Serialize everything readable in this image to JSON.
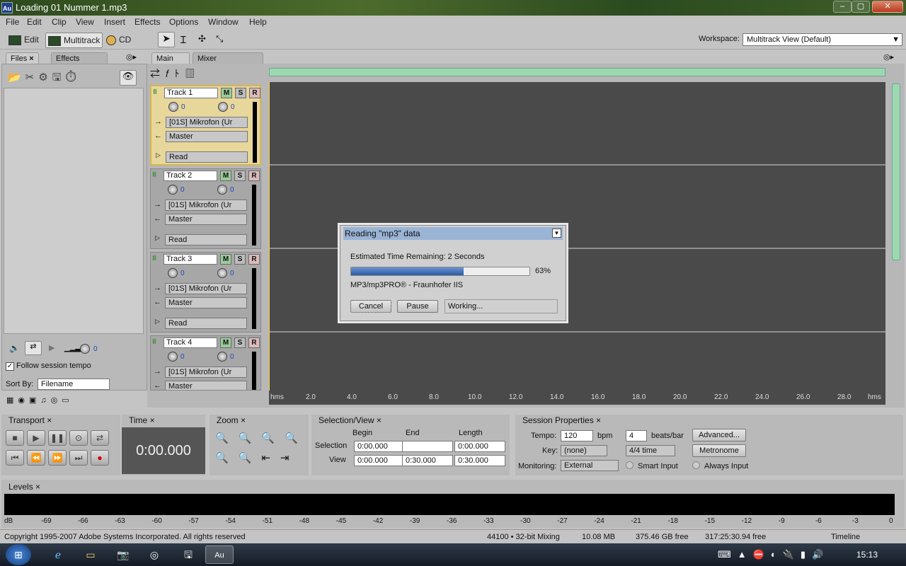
{
  "app": {
    "icon": "Au",
    "title": "Loading 01 Nummer 1.mp3"
  },
  "window_buttons": [
    "–",
    "▢",
    "✕"
  ],
  "menu": [
    "File",
    "Edit",
    "Clip",
    "View",
    "Insert",
    "Effects",
    "Options",
    "Window",
    "Help"
  ],
  "toolbar": {
    "edit": "Edit",
    "multitrack": "Multitrack",
    "cd": "CD",
    "workspace_label": "Workspace:",
    "workspace_value": "Multitrack View (Default)"
  },
  "files_panel": {
    "tabs": [
      "Files",
      "Effects"
    ],
    "close": "×",
    "follow_tempo": "Follow session tempo",
    "sort_by": "Sort By:",
    "sort_value": "Filename",
    "vol": "0"
  },
  "main_tabs": [
    "Main",
    "Mixer"
  ],
  "tracks": [
    {
      "name": "Track 1",
      "vol": "0",
      "pan": "0",
      "input": "[01S] Mikrofon (Ur",
      "output": "Master",
      "auto": "Read"
    },
    {
      "name": "Track 2",
      "vol": "0",
      "pan": "0",
      "input": "[01S] Mikrofon (Ur",
      "output": "Master",
      "auto": "Read"
    },
    {
      "name": "Track 3",
      "vol": "0",
      "pan": "0",
      "input": "[01S] Mikrofon (Ur",
      "output": "Master",
      "auto": "Read"
    },
    {
      "name": "Track 4",
      "vol": "0",
      "pan": "0",
      "input": "[01S] Mikrofon (Ur",
      "output": "Master",
      "auto": ""
    }
  ],
  "msr": [
    "M",
    "S",
    "R"
  ],
  "ruler": [
    "hms",
    "2.0",
    "4.0",
    "6.0",
    "8.0",
    "10.0",
    "12.0",
    "14.0",
    "16.0",
    "18.0",
    "20.0",
    "22.0",
    "24.0",
    "26.0",
    "28.0",
    "hms"
  ],
  "dialog": {
    "title": "Reading \"mp3\" data",
    "eta": "Estimated Time Remaining: 2 Seconds",
    "progress": 0.63,
    "percent": "63%",
    "codec": "MP3/mp3PRO® - Fraunhofer IIS",
    "cancel": "Cancel",
    "pause": "Pause",
    "status": "Working..."
  },
  "transport": {
    "title": "Transport"
  },
  "time": {
    "title": "Time",
    "value": "0:00.000"
  },
  "zoom": {
    "title": "Zoom"
  },
  "selection": {
    "title": "Selection/View",
    "begin": "Begin",
    "end": "End",
    "length": "Length",
    "sel_label": "Selection",
    "view_label": "View",
    "sel_begin": "0:00.000",
    "sel_end": "",
    "sel_len": "0:00.000",
    "view_begin": "0:00.000",
    "view_end": "0:30.000",
    "view_len": "0:30.000"
  },
  "session": {
    "title": "Session Properties",
    "tempo_label": "Tempo:",
    "tempo": "120",
    "bpm": "bpm",
    "beats": "4",
    "beats_label": "beats/bar",
    "advanced": "Advanced...",
    "key_label": "Key:",
    "key": "(none)",
    "time_sig": "4/4 time",
    "metronome": "Metronome",
    "monitoring_label": "Monitoring:",
    "monitoring": "External",
    "smart": "Smart Input",
    "always": "Always Input"
  },
  "levels": {
    "title": "Levels",
    "scale": [
      "dB",
      "-69",
      "-66",
      "-63",
      "-60",
      "-57",
      "-54",
      "-51",
      "-48",
      "-45",
      "-42",
      "-39",
      "-36",
      "-33",
      "-30",
      "-27",
      "-24",
      "-21",
      "-18",
      "-15",
      "-12",
      "-9",
      "-6",
      "-3",
      "0"
    ]
  },
  "status": {
    "copyright": "Copyright 1995-2007 Adobe Systems Incorporated. All rights reserved",
    "mix": "44100 • 32-bit Mixing",
    "mem": "10.08 MB",
    "disk": "375.46 GB free",
    "time_free": "317:25:30.94 free",
    "view": "Timeline"
  },
  "taskbar": {
    "clock": "15:13",
    "app_active": "Au"
  }
}
